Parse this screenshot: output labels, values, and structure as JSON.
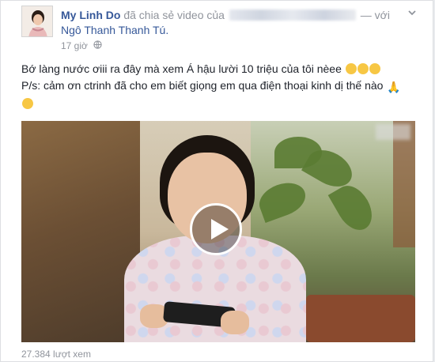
{
  "post": {
    "author": "My Linh Do",
    "action": "đã chia sẻ video của",
    "with_prefix": "— với",
    "tagged_name": "Ngô Thanh Thanh Tú.",
    "time": "17 giờ",
    "globe_icon": "globe-icon",
    "menu_icon": "chevron-down-icon",
    "text_line1": "Bớ làng nước ơiii ra đây mà xem Á hậu lười 10 triệu của tôi nèee",
    "text_line2": "P/s: cảm ơn ctrinh đã cho em biết giọng em qua điện thoại kinh dị thế nào",
    "video_icon": "play-icon",
    "views": "27.384 lượt xem"
  }
}
